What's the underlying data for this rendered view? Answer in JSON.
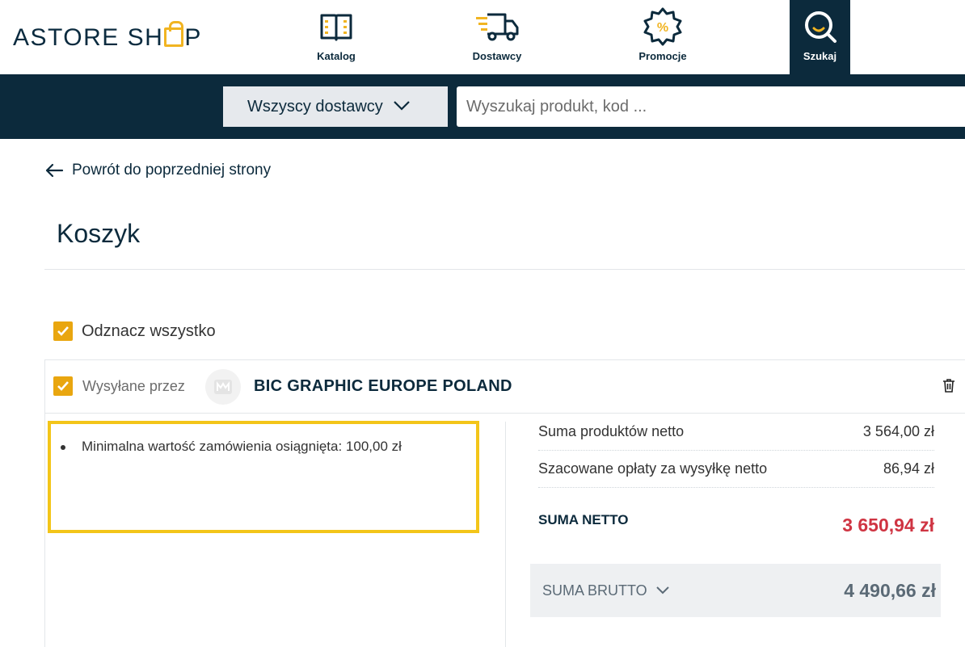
{
  "logo": {
    "part1": "ASTORE SH",
    "part2": "P"
  },
  "nav": {
    "catalog": "Katalog",
    "suppliers": "Dostawcy",
    "promotions": "Promocje",
    "search": "Szukaj"
  },
  "searchbar": {
    "supplier_select": "Wszyscy dostawcy",
    "placeholder": "Wyszukaj produkt, kod ..."
  },
  "back_link": "Powrót do poprzedniej strony",
  "page_title": "Koszyk",
  "select_all": "Odznacz wszystko",
  "supplier_card": {
    "sent_by": "Wysyłane przez",
    "supplier_name": "BIC GRAPHIC EUROPE POLAND",
    "notices": [
      "Minimalna wartość zamówienia osiągnięta: 100,00 zł"
    ],
    "summary": {
      "products_net_label": "Suma produktów netto",
      "products_net_value": "3 564,00 zł",
      "shipping_net_label": "Szacowane opłaty za wysyłkę netto",
      "shipping_net_value": "86,94 zł",
      "total_net_label": "SUMA NETTO",
      "total_net_value": "3 650,94 zł",
      "total_gross_label": "SUMA BRUTTO",
      "total_gross_value": "4 490,66 zł"
    }
  },
  "colors": {
    "navy": "#0c2a3c",
    "accent_yellow": "#f1b421",
    "checkbox_orange": "#e9a60f",
    "notice_border": "#f3c519",
    "total_red": "#cf3442"
  }
}
